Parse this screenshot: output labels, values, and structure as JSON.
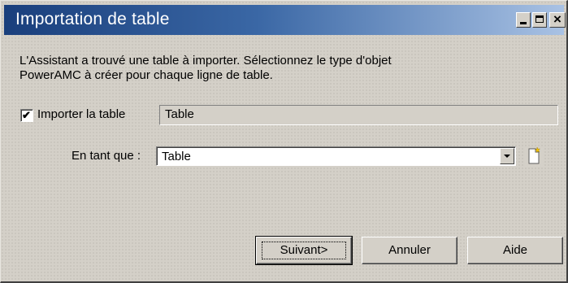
{
  "window": {
    "title": "Importation de table",
    "controls": {
      "minimize": "minimize",
      "maximize": "maximize",
      "close": "×"
    }
  },
  "description": {
    "line1": "L'Assistant a trouvé une table à importer. Sélectionnez le type d'objet",
    "line2": "PowerAMC à créer pour chaque ligne de table."
  },
  "import": {
    "checkbox_label": "Importer la table",
    "checked": true,
    "check_glyph": "✔",
    "table_name": "Table"
  },
  "as_type": {
    "label": "En tant que :",
    "selected": "Table"
  },
  "buttons": {
    "next": "Suivant>",
    "cancel": "Annuler",
    "help": "Aide"
  },
  "colors": {
    "face": "#d4d0c8",
    "title_start": "#1a3f7c",
    "title_end": "#a9c2e4"
  }
}
